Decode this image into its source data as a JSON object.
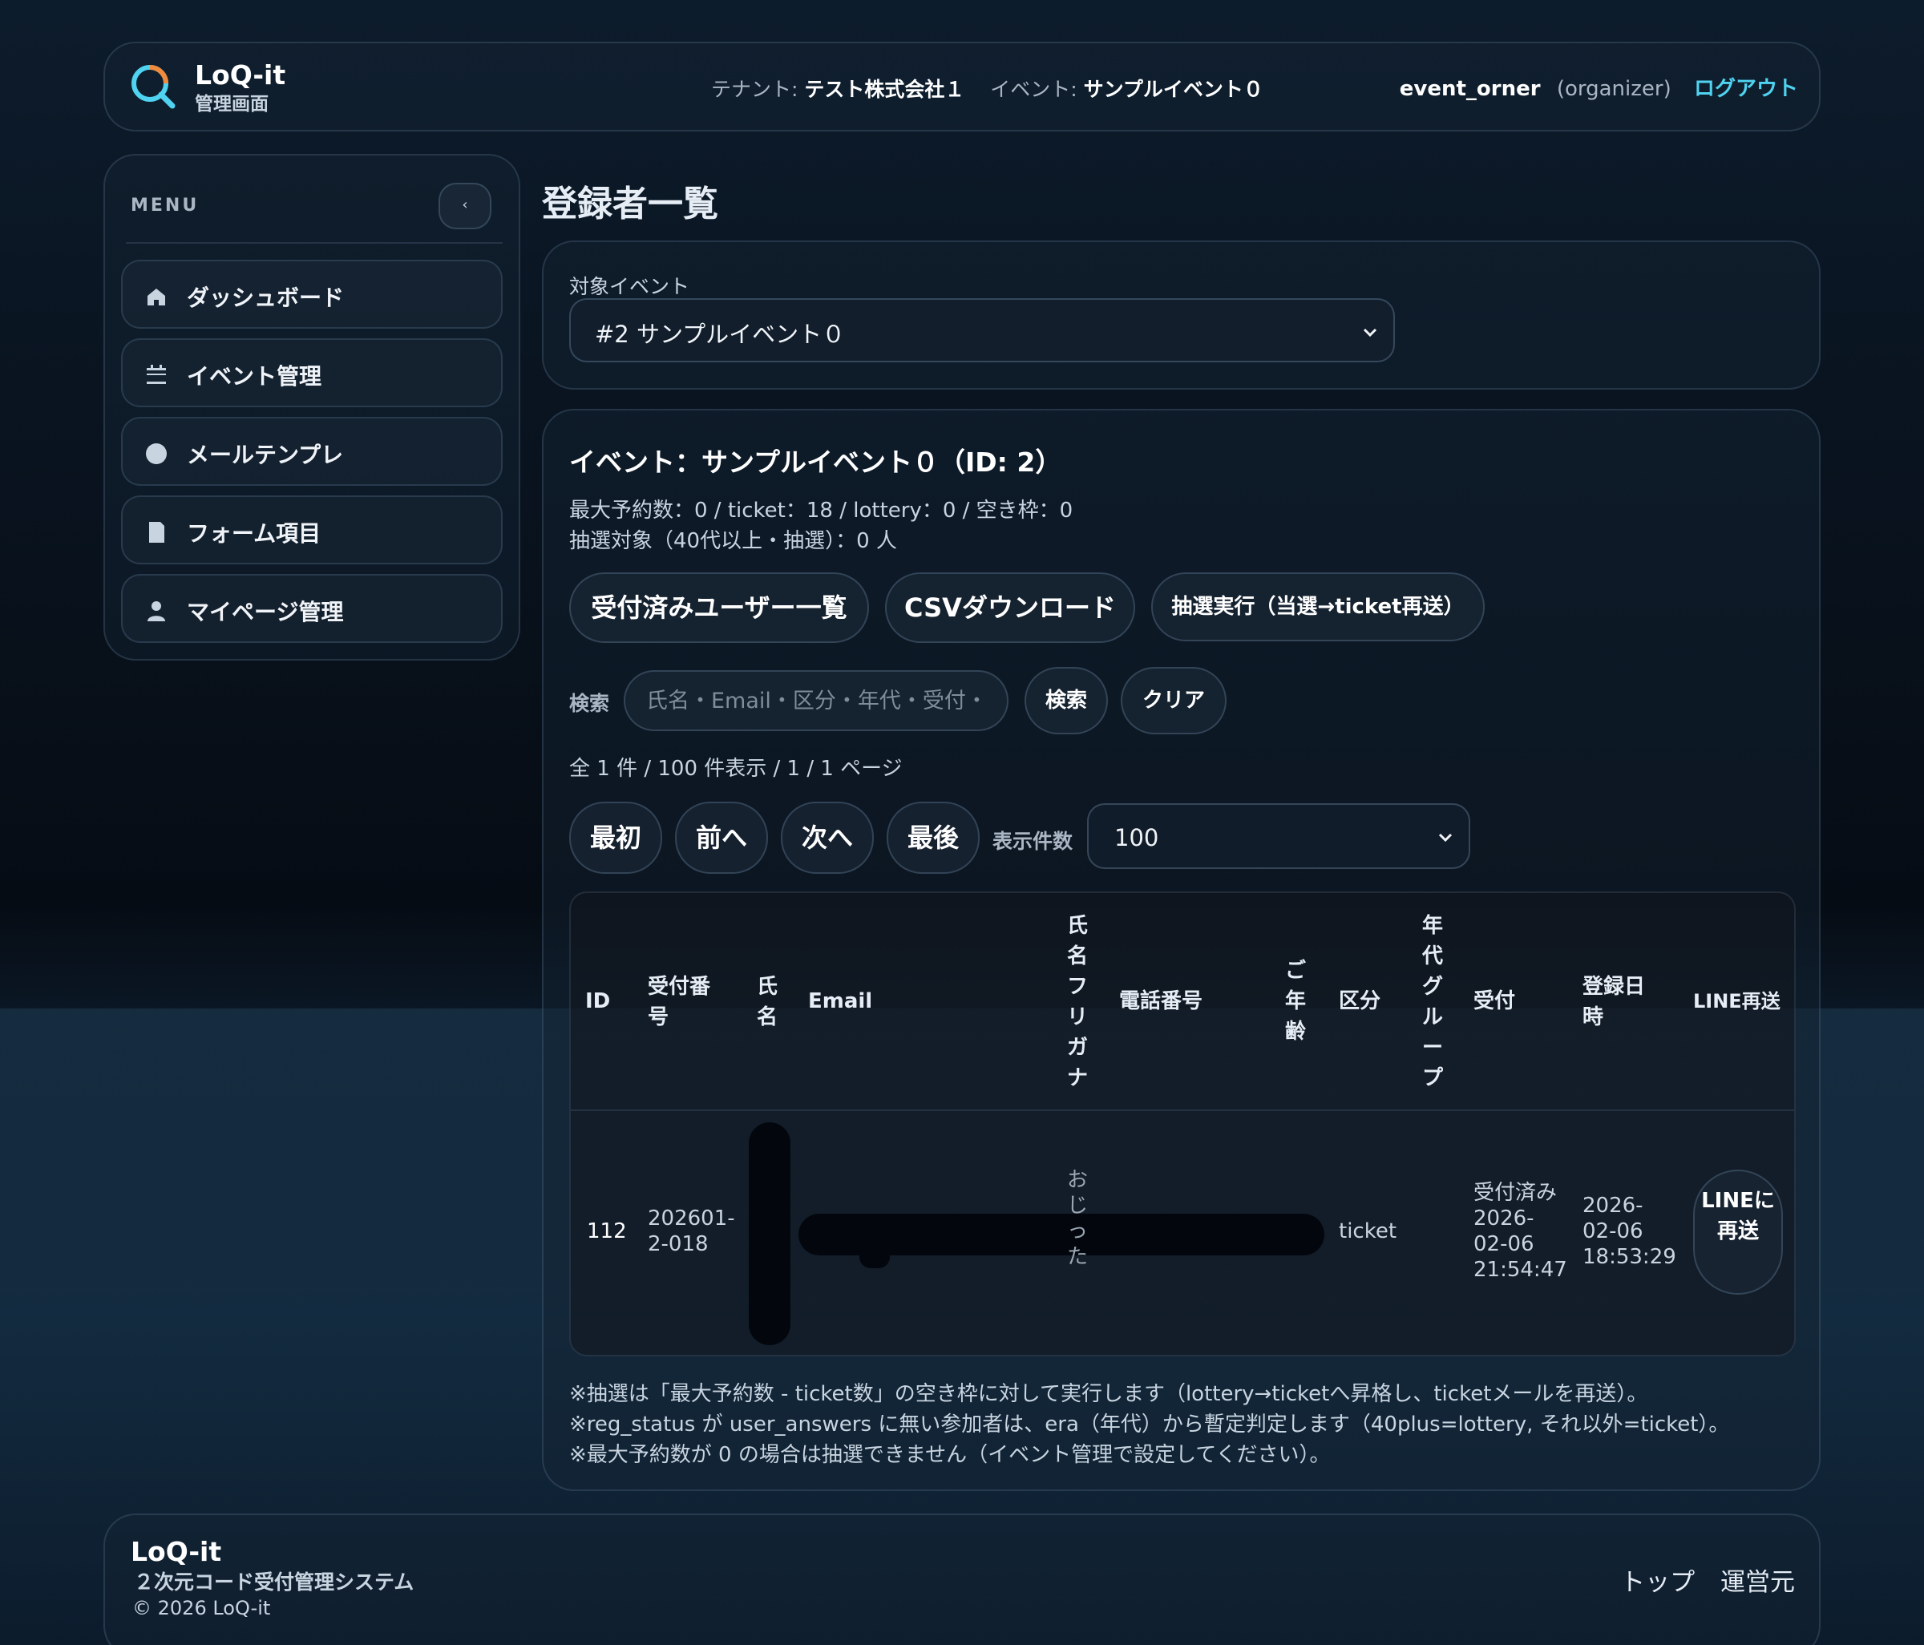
{
  "header": {
    "brand": "LoQ-it",
    "brand_sub": "管理画面",
    "tenant_label": "テナント:",
    "tenant_value": "テスト株式会社１",
    "event_label": "イベント:",
    "event_value": "サンプルイベント０",
    "username": "event_orner",
    "role": "(organizer)",
    "logout": "ログアウト",
    "accent_color": "#4fd3f0"
  },
  "sidebar": {
    "title": "MENU",
    "collapse": "‹",
    "items": [
      {
        "label": "ダッシュボード",
        "icon": "home-icon"
      },
      {
        "label": "イベント管理",
        "icon": "calendar-icon"
      },
      {
        "label": "メールテンプレ",
        "icon": "circle-icon"
      },
      {
        "label": "フォーム項目",
        "icon": "document-icon"
      },
      {
        "label": "マイページ管理",
        "icon": "user-icon"
      }
    ]
  },
  "main": {
    "page_title": "登録者一覧",
    "event_select_label": "対象イベント",
    "event_select_value": "#2 サンプルイベント０",
    "section_title": "イベント：サンプルイベント０（ID: 2）",
    "stats_line1": "最大予約数：0 / ticket：18 / lottery：0 / 空き枠：0",
    "stats_line2": "抽選対象（40代以上・抽選）：0 人",
    "actions": {
      "accepted_users": "受付済みユーザー一覧",
      "csv_download": "CSVダウンロード",
      "run_lottery": "抽選実行（当選→ticket再送）"
    },
    "search": {
      "label": "検索",
      "placeholder": "氏名・Email・区分・年代・受付・",
      "value": "",
      "search_button": "検索",
      "clear_button": "クリア"
    },
    "summary": "全 1 件 / 100 件表示 / 1 / 1 ページ",
    "pager": {
      "first": "最初",
      "prev": "前へ",
      "next": "次へ",
      "last": "最後",
      "per_page_label": "表示件数",
      "per_page_value": "100"
    },
    "table": {
      "columns": [
        "ID",
        "受付番号",
        "氏名",
        "Email",
        "氏名フリガナ",
        "電話番号",
        "ご年齢",
        "区分",
        "年代グループ",
        "受付",
        "登録日時",
        "LINE再送"
      ],
      "rows": [
        {
          "id": "112",
          "reception_no": "202601-2-018",
          "name": "",
          "email": "",
          "furigana": "おじ  った",
          "phone": "",
          "age": "",
          "category": "ticket",
          "era_group": "",
          "reception": "受付済み 2026-02-06 21:54:47",
          "registered_at": "2026-02-06 18:53:29",
          "line_resend": "LINEに再送"
        }
      ]
    },
    "notes": [
      "※抽選は「最大予約数 - ticket数」の空き枠に対して実行します（lottery→ticketへ昇格し、ticketメールを再送）。",
      "※reg_status が user_answers に無い参加者は、era（年代）から暫定判定します（40plus=lottery, それ以外=ticket）。",
      "※最大予約数が 0 の場合は抽選できません（イベント管理で設定してください）。"
    ]
  },
  "footer": {
    "brand": "LoQ-it",
    "subtitle": "２次元コード受付管理システム",
    "copyright": "© 2026 LoQ-it",
    "links": [
      "トップ",
      "運営元"
    ]
  }
}
